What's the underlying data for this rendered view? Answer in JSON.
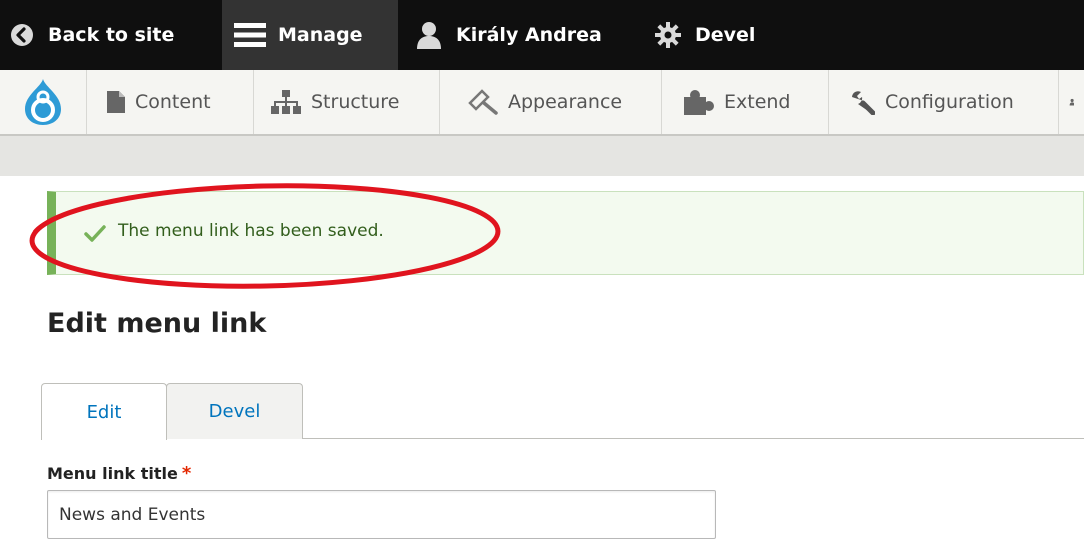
{
  "toolbar": {
    "back_label": "Back to site",
    "manage_label": "Manage",
    "user_label": "Király Andrea",
    "devel_label": "Devel"
  },
  "tray": {
    "items": [
      {
        "label": "Content",
        "icon": "file-icon"
      },
      {
        "label": "Structure",
        "icon": "sitemap-icon"
      },
      {
        "label": "Appearance",
        "icon": "paintbrush-icon"
      },
      {
        "label": "Extend",
        "icon": "puzzle-icon"
      },
      {
        "label": "Configuration",
        "icon": "wrench-icon"
      }
    ]
  },
  "message": {
    "text": "The menu link has been saved.",
    "color": "#77b259"
  },
  "page": {
    "title": "Edit menu link"
  },
  "tabs": [
    {
      "label": "Edit",
      "active": true
    },
    {
      "label": "Devel",
      "active": false
    }
  ],
  "form": {
    "title_label": "Menu link title",
    "required_mark": "*",
    "title_value": "News and Events"
  },
  "colors": {
    "link": "#0074bd",
    "annotation": "#e0141e"
  }
}
